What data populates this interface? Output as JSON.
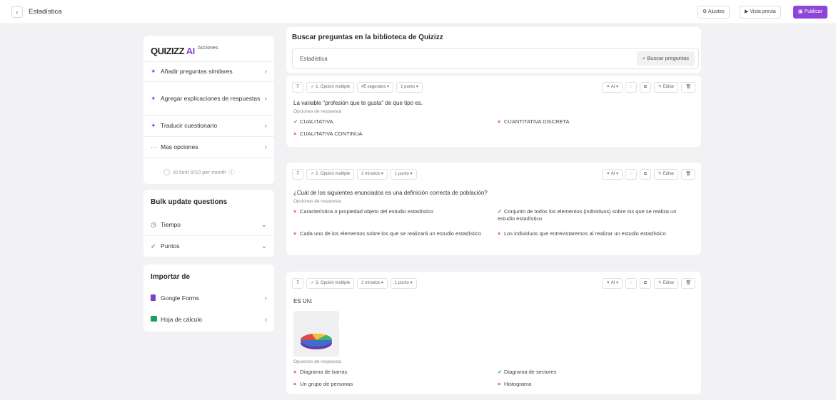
{
  "header": {
    "back_glyph": "‹",
    "title": "Estadística",
    "settings_label": "⚙ Ajustes",
    "preview_label": "▶ Vista previa",
    "publish_label": "▣ Publicar"
  },
  "ai_panel": {
    "logo_main": "QUIZIZZ",
    "logo_ai": "AI",
    "actions_label": "Acciones",
    "items": [
      {
        "label": "Añadir preguntas similares",
        "icon": "sparkle-icon",
        "glyph": "✦"
      },
      {
        "label": "Agregar explicaciones de respuestas",
        "icon": "sparkle-icon",
        "glyph": "✦"
      },
      {
        "label": "Traducir cuestionario",
        "icon": "sparkle-icon",
        "glyph": "✦"
      },
      {
        "label": "Mas opciones",
        "icon": "more-icon",
        "glyph": "···"
      }
    ],
    "limit_text": "AI limit 0/10 per month",
    "limit_info": "ⓘ"
  },
  "bulk": {
    "title": "Bulk update questions",
    "time_label": "Tiempo",
    "points_label": "Puntos"
  },
  "import": {
    "title": "Importar de",
    "google_forms": "Google Forms",
    "spreadsheet": "Hoja de cálculo"
  },
  "library": {
    "title": "Buscar preguntas en la biblioteca de Quizizz",
    "search_value": "Estadistica",
    "search_button": "Buscar preguntas"
  },
  "question_controls": {
    "drag": "⠿",
    "ai": "✦ AI ▾",
    "edit": "✎ Editar",
    "delete": "🗑"
  },
  "questions": [
    {
      "type_label": "✓ 1. Opción multiple",
      "time": "45 segundos ▾",
      "points": "1 punto ▾",
      "text": "La variable \"profesión que te gusta\" de que tipo es.",
      "options_label": "Opciones de respuesta",
      "options": [
        {
          "text": "CUALITATIVA",
          "correct": true
        },
        {
          "text": "CUANTITATIVA DISCRETA",
          "correct": false
        },
        {
          "text": "CUALITATIVA CONTINUA",
          "correct": false
        }
      ]
    },
    {
      "type_label": "✓ 2. Opción multiple",
      "time": "1 minutos ▾",
      "points": "1 punto ▾",
      "text": "¿Cuál de los siguientes enunciados es una definición correcta de población?",
      "options_label": "Opciones de respuesta",
      "options": [
        {
          "text": "Característica o propiedad objeto del estudio estadístico",
          "correct": false
        },
        {
          "text": "Conjunto de todos los elementos (individuos) sobre los que se realiza un estudio estadístico",
          "correct": true
        },
        {
          "text": "Cada uno de los elementos sobre los que se realizará un estudio estadístico",
          "correct": false
        },
        {
          "text": "Los individuos que entrevistaremos al realizar un estudio estadístico",
          "correct": false
        }
      ]
    },
    {
      "type_label": "✓ 3. Opción multiple",
      "time": "1 minutos ▾",
      "points": "1 punto ▾",
      "text": "ES UN:",
      "options_label": "Opciones de respuesta",
      "options": [
        {
          "text": "Diagrama de barras",
          "correct": false
        },
        {
          "text": "Diagrama de sectores",
          "correct": true
        },
        {
          "text": "Un grupo de personas",
          "correct": false
        },
        {
          "text": "Histograma",
          "correct": false
        }
      ]
    }
  ],
  "marks": {
    "correct": "✓",
    "wrong": "×"
  },
  "colors": {
    "accent": "#8e44d8",
    "correct": "#2fa86a",
    "wrong": "#e23d3d"
  }
}
